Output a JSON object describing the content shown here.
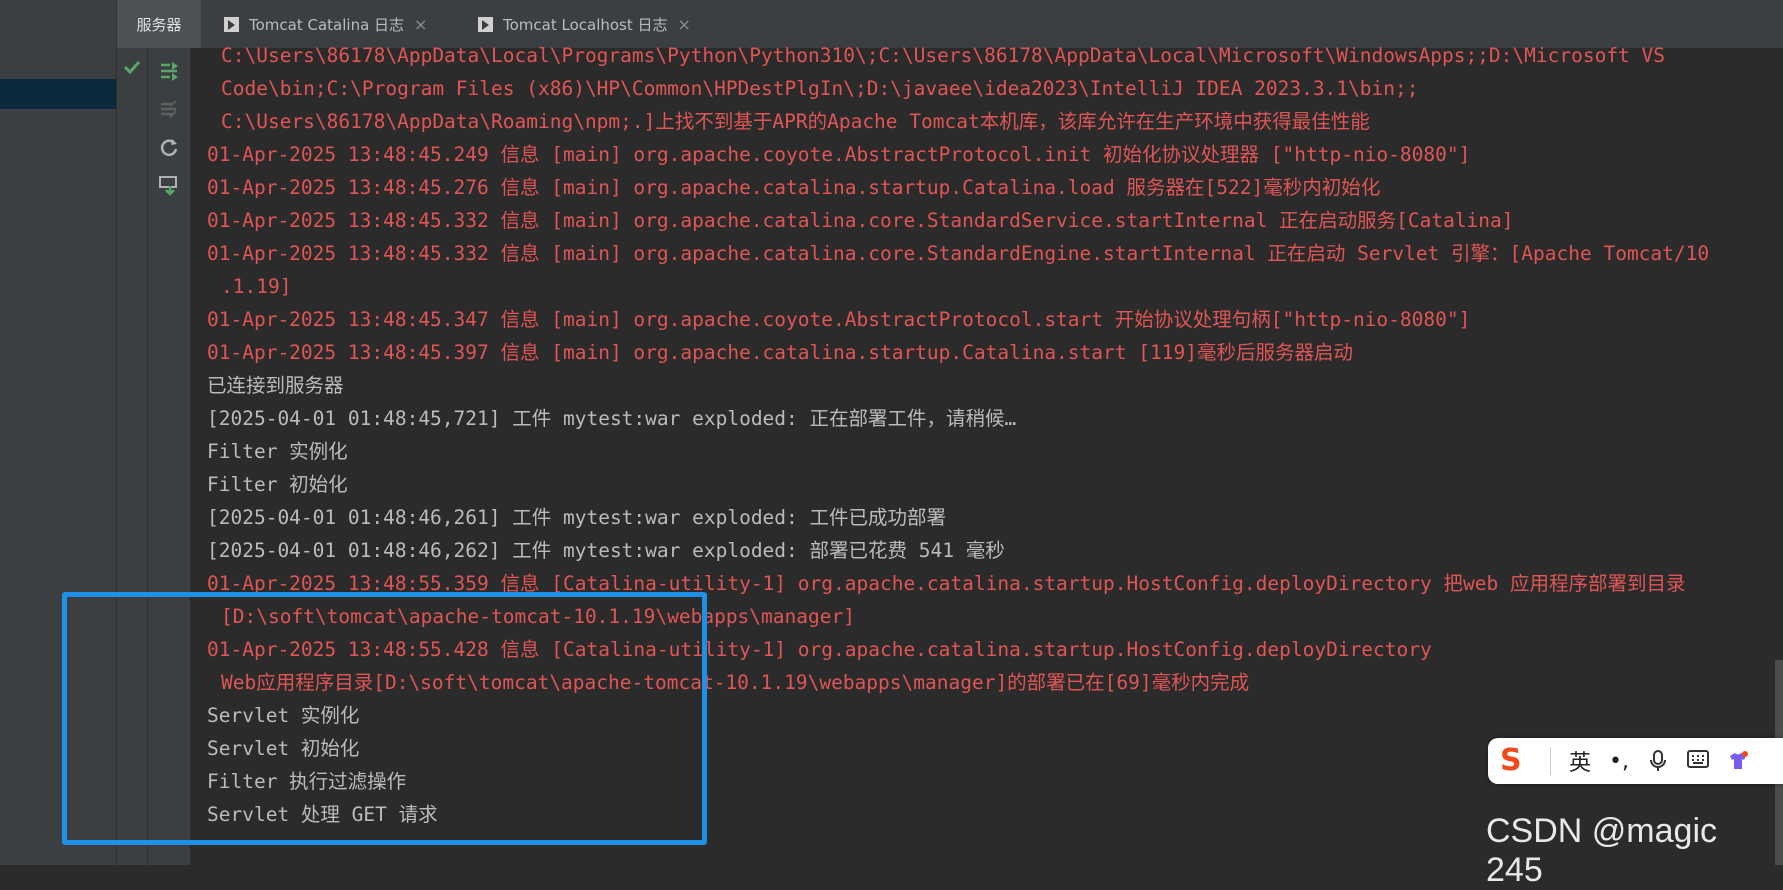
{
  "tabs": [
    {
      "label": "服务器"
    },
    {
      "label": "Tomcat Catalina 日志",
      "close": "×"
    },
    {
      "label": "Tomcat Localhost 日志",
      "close": "×"
    }
  ],
  "toolbar": {
    "icons": [
      "check-icon",
      "redeploy-icon",
      "undeploy-icon",
      "refresh-icon",
      "deploy-icon"
    ]
  },
  "console": {
    "lines": [
      "C:\\Users\\86178\\AppData\\Local\\Programs\\Python\\Python310\\;C:\\Users\\86178\\AppData\\Local\\Microsoft\\WindowsApps;;D:\\Microsoft VS",
      "Code\\bin;C:\\Program Files (x86)\\HP\\Common\\HPDestPlgIn\\;D:\\javaee\\idea2023\\IntelliJ IDEA 2023.3.1\\bin;;",
      "C:\\Users\\86178\\AppData\\Roaming\\npm;.]上找不到基于APR的Apache Tomcat本机库，该库允许在生产环境中获得最佳性能",
      "01-Apr-2025 13:48:45.249 信息 [main] org.apache.coyote.AbstractProtocol.init 初始化协议处理器 [\"http-nio-8080\"]",
      "01-Apr-2025 13:48:45.276 信息 [main] org.apache.catalina.startup.Catalina.load 服务器在[522]毫秒内初始化",
      "01-Apr-2025 13:48:45.332 信息 [main] org.apache.catalina.core.StandardService.startInternal 正在启动服务[Catalina]",
      "01-Apr-2025 13:48:45.332 信息 [main] org.apache.catalina.core.StandardEngine.startInternal 正在启动 Servlet 引擎：[Apache Tomcat/10",
      ".1.19]",
      "01-Apr-2025 13:48:45.347 信息 [main] org.apache.coyote.AbstractProtocol.start 开始协议处理句柄[\"http-nio-8080\"]",
      "01-Apr-2025 13:48:45.397 信息 [main] org.apache.catalina.startup.Catalina.start [119]毫秒后服务器启动",
      "已连接到服务器",
      "[2025-04-01 01:48:45,721] 工件 mytest:war exploded: 正在部署工件，请稍候…",
      "Filter 实例化",
      "Filter 初始化",
      "[2025-04-01 01:48:46,261] 工件 mytest:war exploded: 工件已成功部署",
      "[2025-04-01 01:48:46,262] 工件 mytest:war exploded: 部署已花费 541 毫秒",
      "01-Apr-2025 13:48:55.359 信息 [Catalina-utility-1] org.apache.catalina.startup.HostConfig.deployDirectory 把web 应用程序部署到目录",
      "[D:\\soft\\tomcat\\apache-tomcat-10.1.19\\webapps\\manager]",
      "01-Apr-2025 13:48:55.428 信息 [Catalina-utility-1] org.apache.catalina.startup.HostConfig.deployDirectory",
      "Web应用程序目录[D:\\soft\\tomcat\\apache-tomcat-10.1.19\\webapps\\manager]的部署已在[69]毫秒内完成",
      "Servlet 实例化",
      "Servlet 初始化",
      "Filter 执行过滤操作",
      "Servlet 处理 GET 请求"
    ]
  },
  "ime": {
    "logo": "S",
    "mode": "英",
    "punct": "•,"
  },
  "watermark": "CSDN @magic 245",
  "colors": {
    "error_text": "#e05555",
    "normal_text": "#bbbbbb",
    "highlight_border": "#1e90e6"
  }
}
